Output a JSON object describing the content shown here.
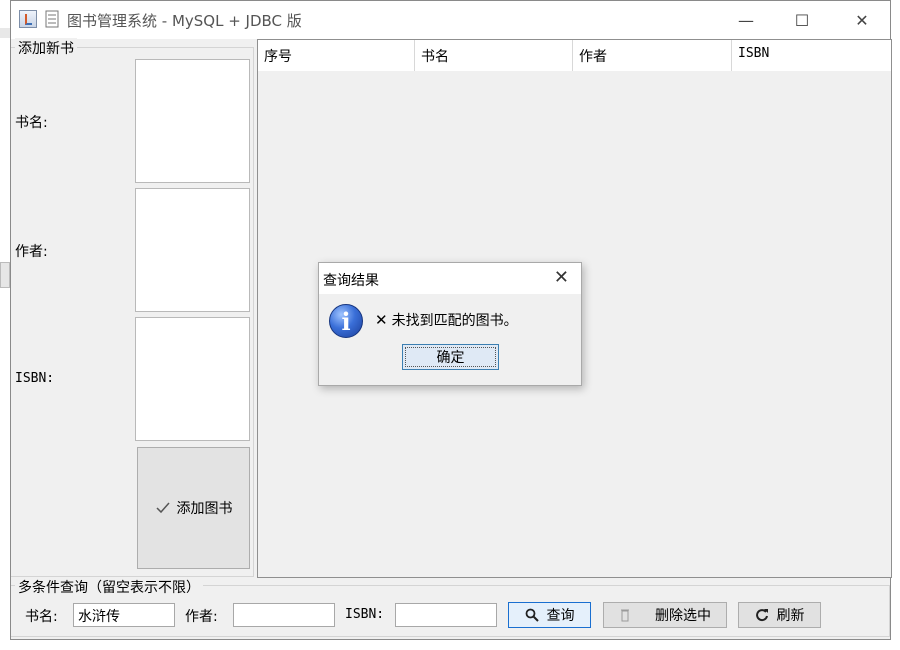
{
  "window": {
    "title": "图书管理系统 - MySQL + JDBC 版",
    "minimize_glyph": "—",
    "maximize_glyph": "☐",
    "close_glyph": "✕"
  },
  "add_panel": {
    "title": "添加新书",
    "labels": {
      "book_name": "书名:",
      "author": "作者:",
      "isbn": "ISBN:"
    },
    "add_button_label": "添加图书",
    "add_button_icon": "check-icon"
  },
  "table": {
    "columns": [
      "序号",
      "书名",
      "作者",
      "ISBN"
    ],
    "rows": []
  },
  "query_panel": {
    "title": "多条件查询（留空表示不限）",
    "book_name_label": "书名:",
    "book_name_value": "水浒传",
    "author_label": "作者:",
    "author_value": "",
    "isbn_label": "ISBN:",
    "isbn_value": "",
    "query_button_label": "查询",
    "delete_button_label": "删除选中",
    "refresh_button_label": "刷新"
  },
  "dialog": {
    "title": "查询结果",
    "icon": "info-icon",
    "icon_glyph": "i",
    "message_mark": "✕",
    "message": "未找到匹配的图书。",
    "ok_label": "确定",
    "close_glyph": "✕"
  }
}
